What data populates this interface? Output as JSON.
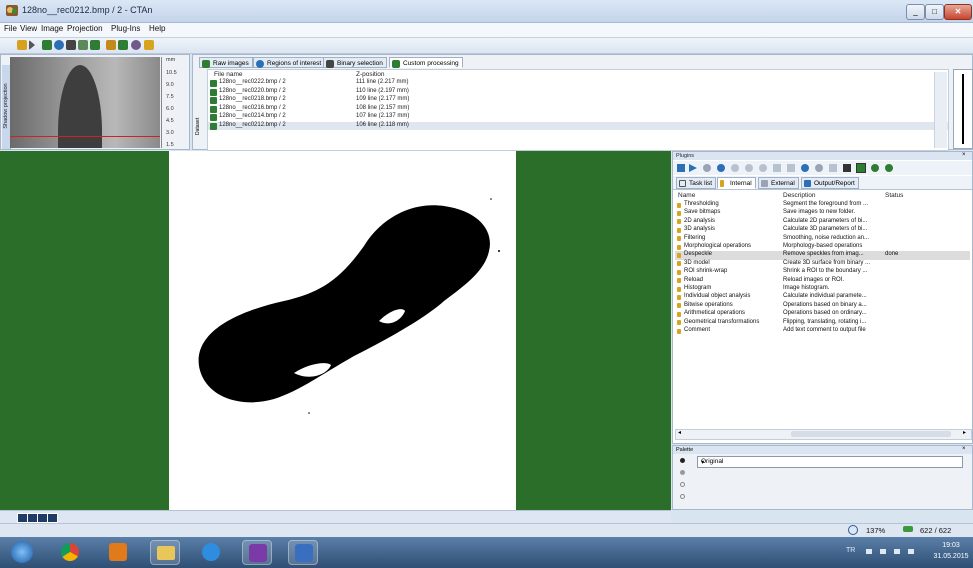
{
  "window": {
    "title": "128no__rec0212.bmp / 2 - CTAn"
  },
  "menu": [
    "File",
    "View",
    "Image",
    "Projection",
    "Plug-Ins",
    "Help"
  ],
  "shadow_projection": {
    "label": "Shadow projection",
    "unit": "mm",
    "scale": [
      "10.5",
      "9.0",
      "7.5",
      "6.0",
      "4.5",
      "3.0",
      "1.5"
    ],
    "dataset_label": "Dataset"
  },
  "file_panel": {
    "tabs": [
      {
        "label": "Raw images",
        "color": "#2f7d32"
      },
      {
        "label": "Regions of interest",
        "color": "#2d6fb5"
      },
      {
        "label": "Binary selection",
        "color": "#444444"
      },
      {
        "label": "Custom processing",
        "color": "#2f7d32"
      }
    ],
    "active_tab": 3,
    "columns": [
      "File name",
      "Z-position"
    ],
    "rows": [
      {
        "name": "128no__rec0222.bmp / 2",
        "pos": "111 line (2.217 mm)"
      },
      {
        "name": "128no__rec0220.bmp / 2",
        "pos": "110 line (2.197 mm)"
      },
      {
        "name": "128no__rec0218.bmp / 2",
        "pos": "109 line (2.177 mm)"
      },
      {
        "name": "128no__rec0216.bmp / 2",
        "pos": "108 line (2.157 mm)"
      },
      {
        "name": "128no__rec0214.bmp / 2",
        "pos": "107 line (2.137 mm)"
      },
      {
        "name": "128no__rec0212.bmp / 2",
        "pos": "106 line (2.118 mm)"
      }
    ],
    "selected_row": 5
  },
  "plugins": {
    "title": "Plugins",
    "tabs": [
      "Task list",
      "Internal",
      "External",
      "Output/Report"
    ],
    "active_tab": 1,
    "columns": [
      "Name",
      "Description",
      "Status"
    ],
    "rows": [
      {
        "name": "Thresholding",
        "desc": "Segment the foreground from ...",
        "status": ""
      },
      {
        "name": "Save bitmaps",
        "desc": "Save images to new folder.",
        "status": ""
      },
      {
        "name": "2D analysis",
        "desc": "Calculate 2D parameters of bi...",
        "status": ""
      },
      {
        "name": "3D analysis",
        "desc": "Calculate 3D parameters of bi...",
        "status": ""
      },
      {
        "name": "Filtering",
        "desc": "Smoothing, noise reduction an...",
        "status": ""
      },
      {
        "name": "Morphological operations",
        "desc": "Morphology-based operations",
        "status": ""
      },
      {
        "name": "Despeckle",
        "desc": "Remove speckles from imag...",
        "status": "done"
      },
      {
        "name": "3D model",
        "desc": "Create 3D surface from binary ...",
        "status": ""
      },
      {
        "name": "ROI shrink-wrap",
        "desc": "Shrink a ROI to the boundary ...",
        "status": ""
      },
      {
        "name": "Reload",
        "desc": "Reload images or ROI.",
        "status": ""
      },
      {
        "name": "Histogram",
        "desc": "Image histogram.",
        "status": ""
      },
      {
        "name": "Individual object analysis",
        "desc": "Calculate individual paramete...",
        "status": ""
      },
      {
        "name": "Bitwise operations",
        "desc": "Operations based on binary a...",
        "status": ""
      },
      {
        "name": "Arithmetical operations",
        "desc": "Operations based on ordinary...",
        "status": ""
      },
      {
        "name": "Geometrical transformations",
        "desc": "Flipping, translating, rotating i...",
        "status": ""
      },
      {
        "name": "Comment",
        "desc": "Add text comment to output file",
        "status": ""
      }
    ],
    "selected_row": 6
  },
  "palette": {
    "title": "Palette",
    "selected": "Original"
  },
  "status": {
    "zoom": "137%",
    "count": "622 / 622"
  },
  "taskbar": {
    "lang": "TR",
    "time": "19:03",
    "date": "31.05.2015",
    "apps": [
      {
        "name": "start-orb",
        "color": "#3a86d6"
      },
      {
        "name": "chrome",
        "color": "#e0a21a"
      },
      {
        "name": "outlook",
        "color": "#e07a1a"
      },
      {
        "name": "explorer",
        "color": "#e8c65a"
      },
      {
        "name": "ie",
        "color": "#2f8de0"
      },
      {
        "name": "ctan",
        "color": "#7a3aa8"
      },
      {
        "name": "app7",
        "color": "#3a6fc0"
      }
    ]
  }
}
